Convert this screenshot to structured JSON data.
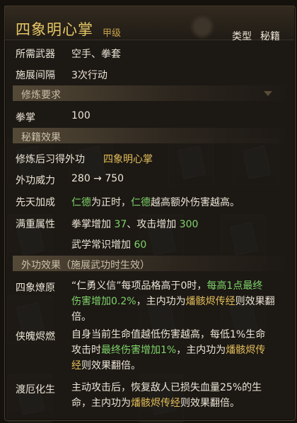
{
  "header": {
    "title": "四象明心掌",
    "grade": "甲级",
    "type_label": "类型",
    "type_value": "秘籍"
  },
  "basic": {
    "weapon_label": "所需武器",
    "weapon_value": "空手、拳套",
    "interval_label": "施展间隔",
    "interval_value": "3次行动"
  },
  "training": {
    "section_title": "修炼要求",
    "fist_label": "拳掌",
    "fist_value": "100"
  },
  "effects": {
    "section_title": "秘籍效果",
    "learn_label": "修炼后习得外功",
    "learn_value": "四象明心掌",
    "power_label": "外功威力",
    "power_value": "280 → 750",
    "bonus_label": "先天加成",
    "bonus_parts": [
      "仁德",
      "为正时，",
      "仁德",
      "越高额外伤害越高。"
    ],
    "full_label": "满重属性",
    "full_line1": [
      "拳掌增加 ",
      "37",
      "、攻击增加 ",
      "300"
    ],
    "full_line2": [
      "武学常识增加 ",
      "60"
    ]
  },
  "external": {
    "section_title": "外功效果（施展武功时生效）",
    "sixiang": {
      "label": "四象燎原",
      "line1": [
        "“仁勇义信”每项品格高于0时，",
        "每高1点最终"
      ],
      "line2": [
        "伤害增加0.2%",
        "，主内功为",
        "燔骸烬传经",
        "则效果翻"
      ],
      "line3": "倍。"
    },
    "xiapo": {
      "label": "侠魄烬燃",
      "line1": "自身当前生命值越低伤害越高，每低1%生命",
      "line2": [
        "攻击时",
        "最终伤害增加1%",
        "，主内功为",
        "燔骸烬传"
      ],
      "line3": [
        "经",
        "则效果翻倍。"
      ]
    },
    "duer": {
      "label": "渡厄化生",
      "line1": "主动攻击后，恢复敌人已损失血量25%的生",
      "line2": [
        "命，主内功为",
        "燔骸烬传经",
        "则效果翻倍。"
      ]
    }
  },
  "colors": {
    "title": "#e7c766",
    "gold": "#e3be5a",
    "green": "#7fd46a",
    "text": "#ece5d6",
    "section_bg": "#5f523e"
  },
  "background_icons": [
    "book-icon",
    "avatar-icon"
  ]
}
